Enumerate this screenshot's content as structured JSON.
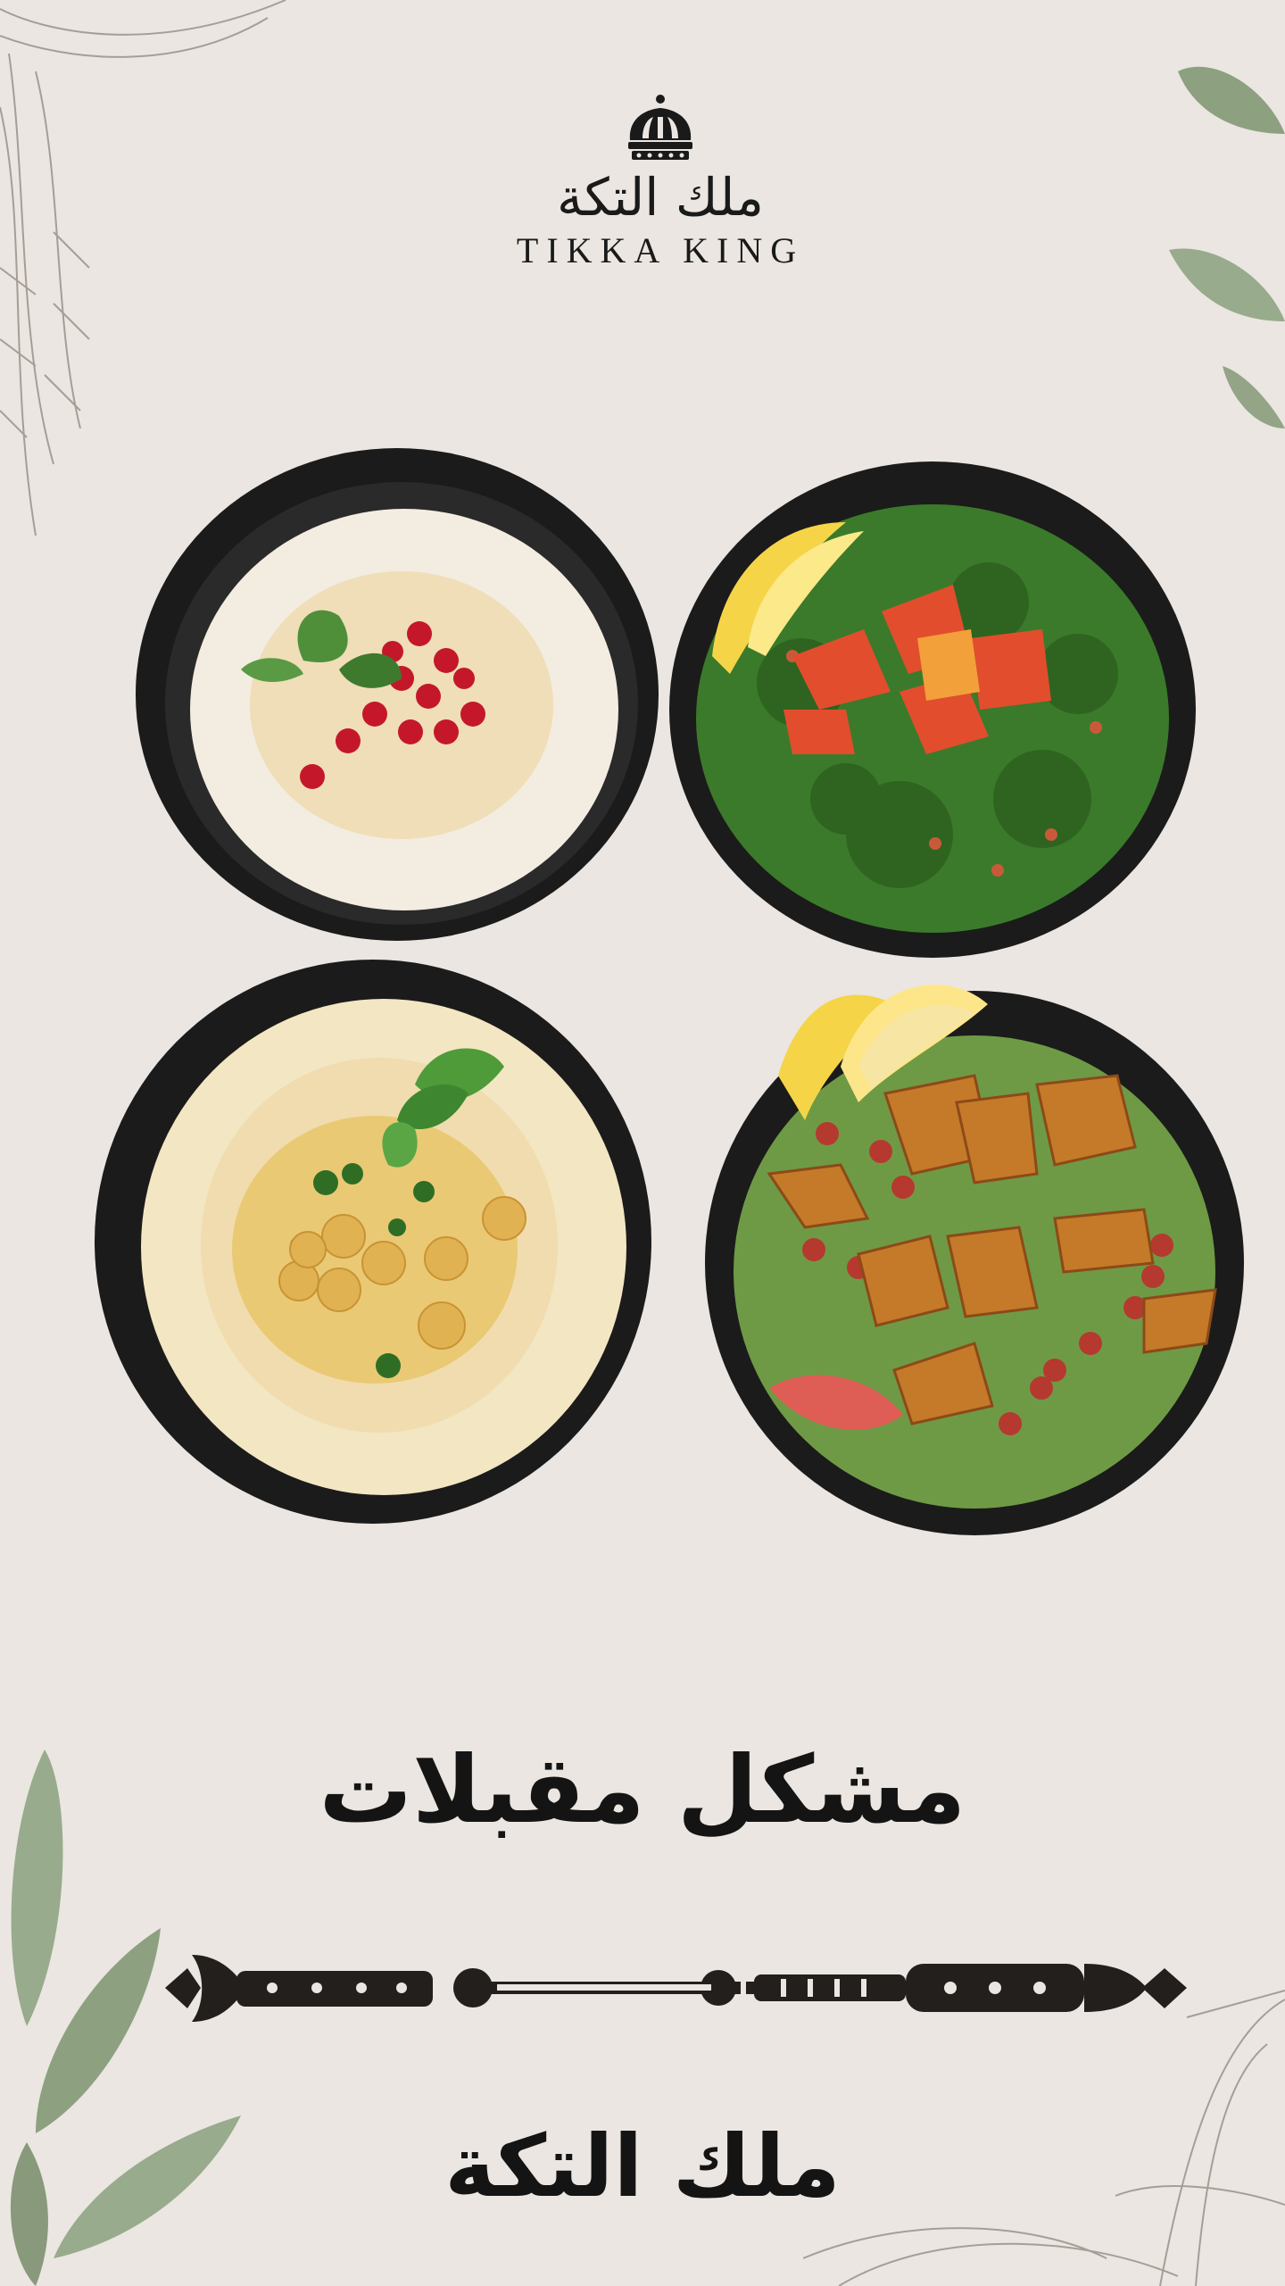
{
  "brand": {
    "name_ar": "ملك التكة",
    "name_en": "TIKKA KING"
  },
  "poster": {
    "title_ar": "مشكل مقبلات",
    "footer_ar": "ملك التكة"
  },
  "dishes": [
    {
      "name": "mutabal",
      "position": "top-left"
    },
    {
      "name": "tabbouleh",
      "position": "top-right"
    },
    {
      "name": "hummus",
      "position": "bottom-left"
    },
    {
      "name": "fattoush",
      "position": "bottom-right"
    }
  ],
  "icons": [
    "crown-icon",
    "ornamental-scepter-divider",
    "olive-leaf-decoration",
    "sketch-decoration"
  ],
  "colors": {
    "background": "#ebe6e1",
    "text": "#141414",
    "bowl": "#1b1b1b",
    "leaf": "#7d9470"
  }
}
